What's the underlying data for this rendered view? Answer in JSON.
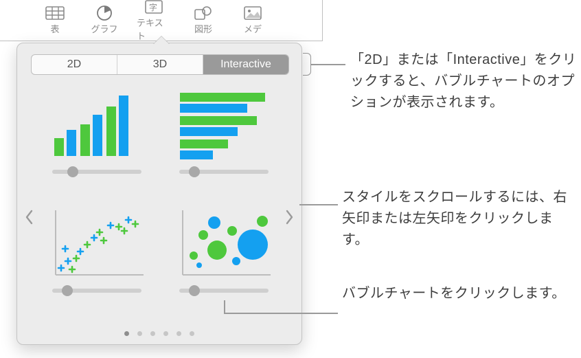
{
  "toolbar": {
    "items": [
      {
        "label": "表",
        "icon": "table-icon"
      },
      {
        "label": "グラフ",
        "icon": "chart-pie-icon",
        "active": true
      },
      {
        "label": "テキスト",
        "icon": "text-icon"
      },
      {
        "label": "図形",
        "icon": "shape-icon"
      },
      {
        "label": "メデ",
        "icon": "media-icon",
        "truncated": true
      }
    ]
  },
  "popover": {
    "segments": [
      {
        "label": "2D"
      },
      {
        "label": "3D"
      },
      {
        "label": "Interactive",
        "active": true
      }
    ],
    "page_count": 6,
    "active_page": 0
  },
  "annotations": {
    "a1": "「2D」または「Interactive」をクリックすると、バブルチャートのオプションが表示されます。",
    "a2": "スタイルをスクロールするには、右矢印または左矢印をクリックします。",
    "a3": "バブルチャートをクリックします。"
  },
  "colors": {
    "green": "#4ec83d",
    "blue": "#14a0f0",
    "gray": "#9a9a9a"
  }
}
